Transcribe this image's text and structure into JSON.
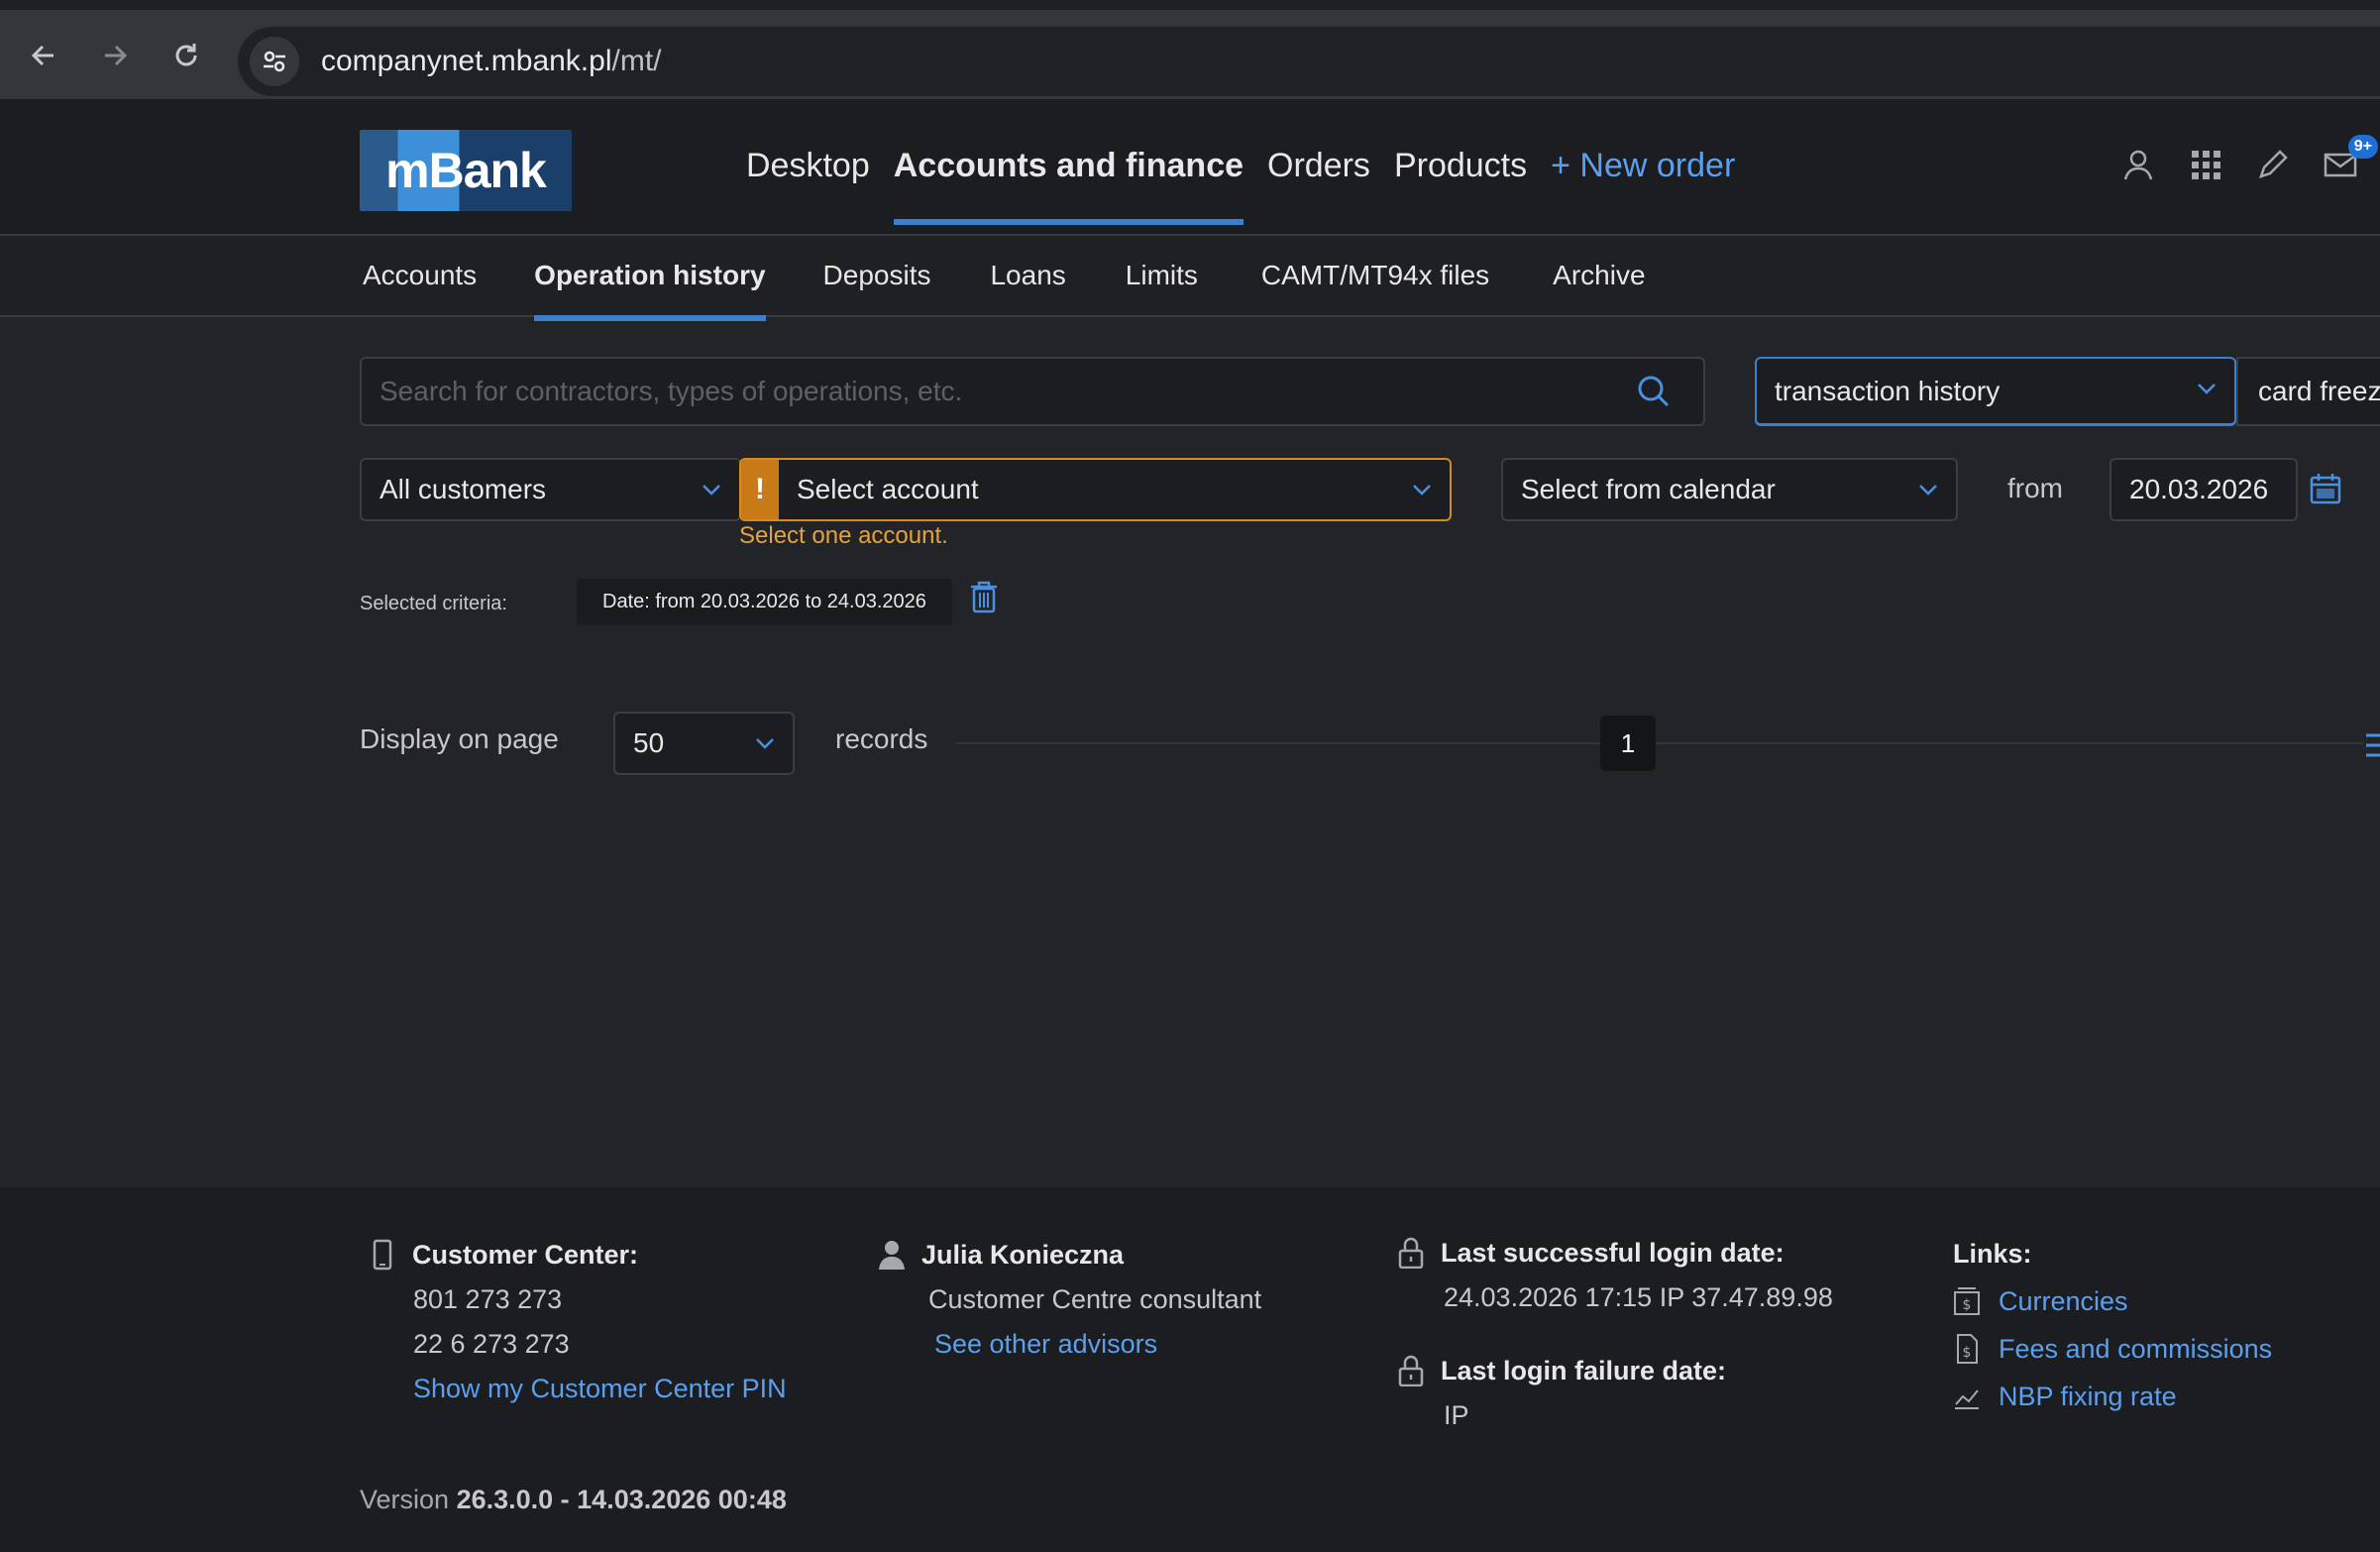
{
  "browser": {
    "url_domain": "companynet.mbank.pl",
    "url_path": "/mt/"
  },
  "header": {
    "logo_text": "mBank",
    "nav": [
      {
        "label": "Desktop"
      },
      {
        "label": "Accounts and finance"
      },
      {
        "label": "Orders"
      },
      {
        "label": "Products"
      },
      {
        "label": "+ New order"
      }
    ],
    "notifications_badge": "9+"
  },
  "subnav": {
    "items": [
      {
        "label": "Accounts"
      },
      {
        "label": "Operation history"
      },
      {
        "label": "Deposits"
      },
      {
        "label": "Loans"
      },
      {
        "label": "Limits"
      },
      {
        "label": "CAMT/MT94x files"
      },
      {
        "label": "Archive"
      }
    ]
  },
  "filters": {
    "search_placeholder": "Search for contractors, types of operations, etc.",
    "history_type": "transaction history",
    "tab_peek": "card freeze",
    "customers": "All customers",
    "account": "Select account",
    "account_warning_mark": "!",
    "account_warning": "Select one account.",
    "date_mode": "Select from calendar",
    "from_label": "from",
    "from_date": "20.03.2026",
    "criteria_label": "Selected criteria:",
    "criteria_chip": "Date: from 20.03.2026 to 24.03.2026"
  },
  "pager": {
    "label": "Display on page",
    "per_page": "50",
    "records_label": "records",
    "current_page": "1"
  },
  "footer": {
    "customer_center": {
      "title": "Customer Center:",
      "phone1": "801 273 273",
      "phone2": "22 6 273 273",
      "pin_link": "Show my Customer Center PIN"
    },
    "advisor": {
      "name": "Julia Konieczna",
      "role": "Customer Centre consultant",
      "link": "See other advisors"
    },
    "login": {
      "success_title": "Last successful login date:",
      "success_value": "24.03.2026  17:15  IP 37.47.89.98",
      "failure_title": "Last login failure date:",
      "failure_value": "IP"
    },
    "links": {
      "title": "Links:",
      "items": [
        {
          "label": "Currencies"
        },
        {
          "label": "Fees and commissions"
        },
        {
          "label": "NBP fixing rate"
        }
      ]
    },
    "version_prefix": "Version ",
    "version_number": "26.3.0.0",
    "version_sep": " - ",
    "version_date": "14.03.2026 00:48"
  }
}
